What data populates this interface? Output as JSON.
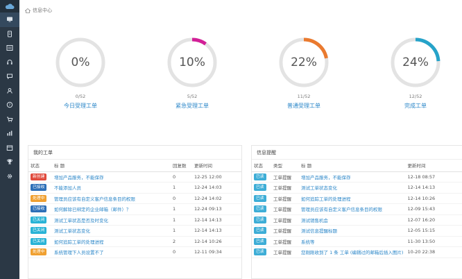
{
  "colors": {
    "sidebar_bg": "#2b3845",
    "link": "#2a86c8",
    "ring_track": "#e3e3e3",
    "ring_colors": [
      "#cccccc",
      "#d21f97",
      "#ea7a2f",
      "#26a3c9"
    ],
    "badge_colors": {
      "新创建": "#e04a3c",
      "已接收": "#2d6fb7",
      "处理中": "#f0a030",
      "已关闭": "#29b3d6",
      "已读": "#3dadd6"
    }
  },
  "sidebar": {
    "logo_icon": "cloud-icon",
    "items": [
      {
        "icon": "monitor-icon",
        "active": true
      },
      {
        "icon": "document-icon"
      },
      {
        "icon": "list-icon"
      },
      {
        "icon": "headset-icon"
      },
      {
        "icon": "chat-icon"
      },
      {
        "icon": "user-icon"
      },
      {
        "icon": "help-icon"
      },
      {
        "icon": "cart-icon"
      },
      {
        "icon": "bar-chart-icon"
      },
      {
        "icon": "calendar-icon"
      },
      {
        "icon": "trophy-icon"
      },
      {
        "icon": "gear-icon"
      }
    ]
  },
  "breadcrumb": {
    "label": "信息中心"
  },
  "stats": [
    {
      "percent": "0%",
      "fraction": "0/52",
      "name": "今日受理工单",
      "value": 0
    },
    {
      "percent": "10%",
      "fraction": "5/52",
      "name": "紧急受理工单",
      "value": 0.1
    },
    {
      "percent": "22%",
      "fraction": "11/52",
      "name": "普通受理工单",
      "value": 0.22
    },
    {
      "percent": "24%",
      "fraction": "12/52",
      "name": "完成工单",
      "value": 0.24
    }
  ],
  "my_tickets": {
    "title": "我的工单",
    "headers": {
      "status": "状态",
      "title": "标 题",
      "replies": "回复数",
      "time": "更新时间"
    },
    "rows": [
      {
        "status": "新创建",
        "title": "增加产品服务，不能保存",
        "replies": "0",
        "time": "12-25 12:00"
      },
      {
        "status": "已接收",
        "title": "不能添加人员",
        "replies": "1",
        "time": "12-24 14:03"
      },
      {
        "status": "处理中",
        "title": "管理员应该有自定义客户信息条目的权限",
        "replies": "0",
        "time": "12-24 14:02"
      },
      {
        "status": "已接收",
        "title": "如何解除已绑定的企业邮箱（邮件）？",
        "replies": "1",
        "time": "12-24 09:13"
      },
      {
        "status": "已关闭",
        "title": "测试工单状态是否及时变化",
        "replies": "1",
        "time": "12-14 14:13"
      },
      {
        "status": "已关闭",
        "title": "测试工单状态变化",
        "replies": "1",
        "time": "12-14 14:13"
      },
      {
        "status": "已关闭",
        "title": "如何追踪工单的处理进程",
        "replies": "2",
        "time": "12-14 10:26"
      },
      {
        "status": "处理中",
        "title": "系统管理下人员设置不了",
        "replies": "0",
        "time": "12-11 09:34"
      }
    ]
  },
  "notices": {
    "title": "信息提醒",
    "headers": {
      "status": "状态",
      "type": "类型",
      "title": "标 题",
      "time": "更新时间"
    },
    "rows": [
      {
        "status": "已读",
        "type": "工单提醒",
        "title": "增加产品服务，不能保存",
        "time": "12-18 08:57"
      },
      {
        "status": "已读",
        "type": "工单提醒",
        "title": "测试工单状态变化",
        "time": "12-14 14:13"
      },
      {
        "status": "已读",
        "type": "工单提醒",
        "title": "如何追踪工单的处理进程",
        "time": "12-14 10:26"
      },
      {
        "status": "已读",
        "type": "工单提醒",
        "title": "管理员应该有自定义客户信息条目的权限",
        "time": "12-09 15:43"
      },
      {
        "status": "已读",
        "type": "工单提醒",
        "title": "测试销售机会",
        "time": "12-07 16:20"
      },
      {
        "status": "已读",
        "type": "工单提醒",
        "title": "测试信息提醒标题",
        "time": "12-05 15:15"
      },
      {
        "status": "已读",
        "type": "工单提醒",
        "title": "系统等",
        "time": "11-30 13:50"
      },
      {
        "status": "已读",
        "type": "工单提醒",
        "title": "您刚刚收到了 1 条 工单 (编辑过的邮箱后插入图片)",
        "time": "10-20 22:38"
      }
    ]
  }
}
